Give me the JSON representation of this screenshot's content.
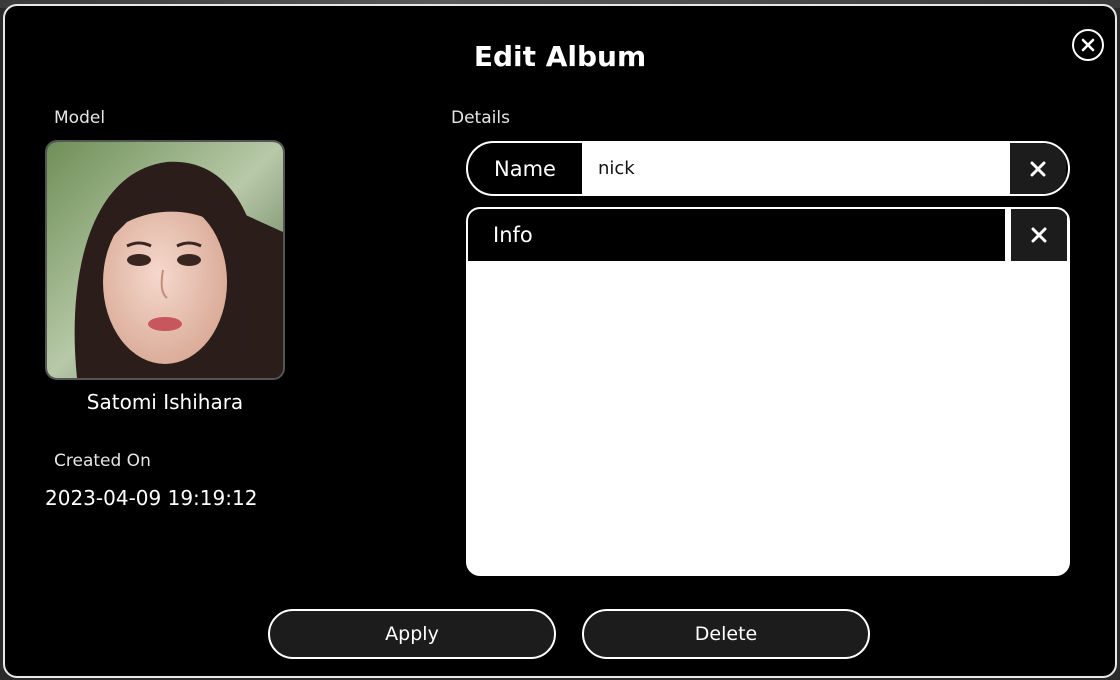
{
  "dialog": {
    "title": "Edit Album",
    "close_icon": "close-circle-icon"
  },
  "model": {
    "label": "Model",
    "name": "Satomi Ishihara",
    "photo_icon": "portrait-photo"
  },
  "created": {
    "label": "Created On",
    "value": "2023-04-09 19:19:12"
  },
  "details": {
    "label": "Details",
    "name_label": "Name",
    "name_value": "nick",
    "info_label": "Info",
    "info_value": "",
    "clear_icon": "close-x-icon"
  },
  "actions": {
    "apply_label": "Apply",
    "delete_label": "Delete"
  },
  "colors": {
    "background": "#000000",
    "border": "#ffffff",
    "button_fill": "#1c1c1c",
    "input_fill": "#ffffff"
  }
}
